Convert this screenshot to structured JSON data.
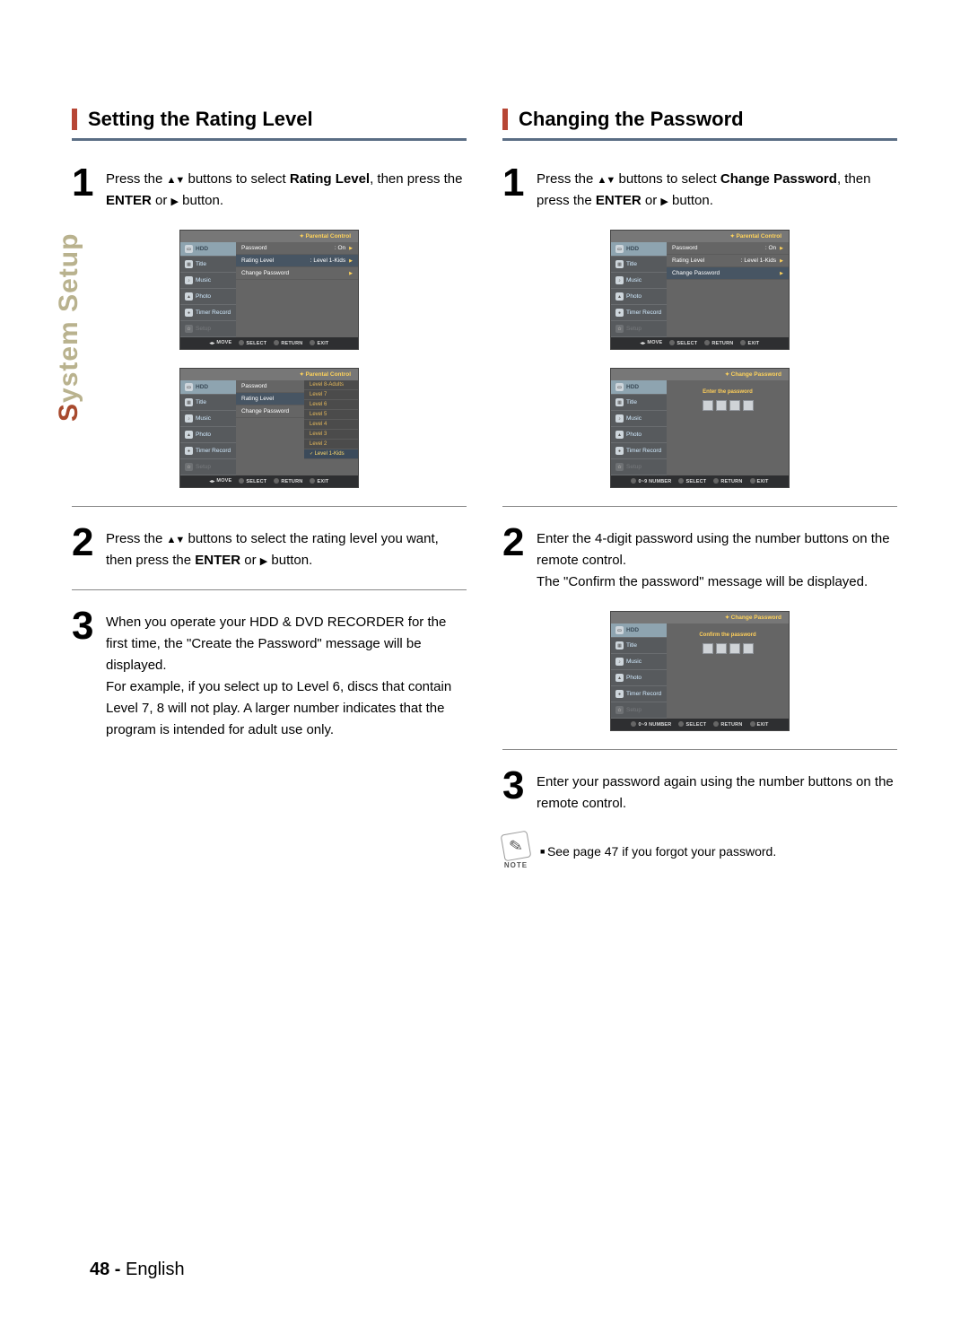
{
  "sidebar": {
    "label_prefix": "S",
    "label_rest": "ystem Setup"
  },
  "left": {
    "heading": "Setting the Rating Level",
    "step1_a": "Press the ",
    "step1_b": " buttons to select ",
    "step1_target": "Rating Level",
    "step1_c": ", then press the ",
    "step1_enter": "ENTER",
    "step1_d": " or ",
    "step1_e": " button.",
    "step2_a": "Press the ",
    "step2_b": " buttons to select the rating level you want, then press the ",
    "step2_enter": "ENTER",
    "step2_c": " or ",
    "step2_d": " button.",
    "step3_a": "When you operate your HDD & DVD RECORDER for the first time, the \"Create the Password\" message will be displayed.",
    "step3_b": "For example, if you select up to Level 6, discs that contain Level 7, 8 will not play. A larger number indicates that the program is intended for adult use only."
  },
  "right": {
    "heading": "Changing the Password",
    "step1_a": "Press the ",
    "step1_b": " buttons to select ",
    "step1_target": "Change Password",
    "step1_c": ", then press the ",
    "step1_enter": "ENTER",
    "step1_d": " or ",
    "step1_e": " button.",
    "step2_a": "Enter the 4-digit password using the number buttons on the remote control.",
    "step2_b": "The \"Confirm the password\" message will be displayed.",
    "step3": "Enter your password again using the number buttons on the remote control.",
    "note_label": "NOTE",
    "note": "See page 47 if you forgot your password."
  },
  "osd": {
    "nav": {
      "hdd": "HDD",
      "title": "Title",
      "music": "Music",
      "photo": "Photo",
      "timer": "Timer Record",
      "setup": "Setup"
    },
    "btmbar": {
      "move": "MOVE",
      "select": "SELECT",
      "ret": "RETURN",
      "exit": "EXIT",
      "num": "0~9 NUMBER"
    },
    "parental": {
      "title": "Parental Control",
      "password": "Password",
      "password_val": ": On",
      "rating": "Rating Level",
      "rating_val": ": Level 1-Kids",
      "change": "Change Password"
    },
    "levels": {
      "title": "Parental Control",
      "password": "Password",
      "rating": "Rating Level",
      "change": "Change Password",
      "l8": "Level 8-Adults",
      "l7": "Level 7",
      "l6": "Level 6",
      "l5": "Level 5",
      "l4": "Level 4",
      "l3": "Level 3",
      "l2": "Level 2",
      "l1": "Level 1-Kids"
    },
    "changepw": {
      "title": "Change Password",
      "enter": "Enter the password",
      "confirm": "Confirm the password"
    }
  },
  "footer": {
    "page": "48 -",
    "lang": " English"
  }
}
